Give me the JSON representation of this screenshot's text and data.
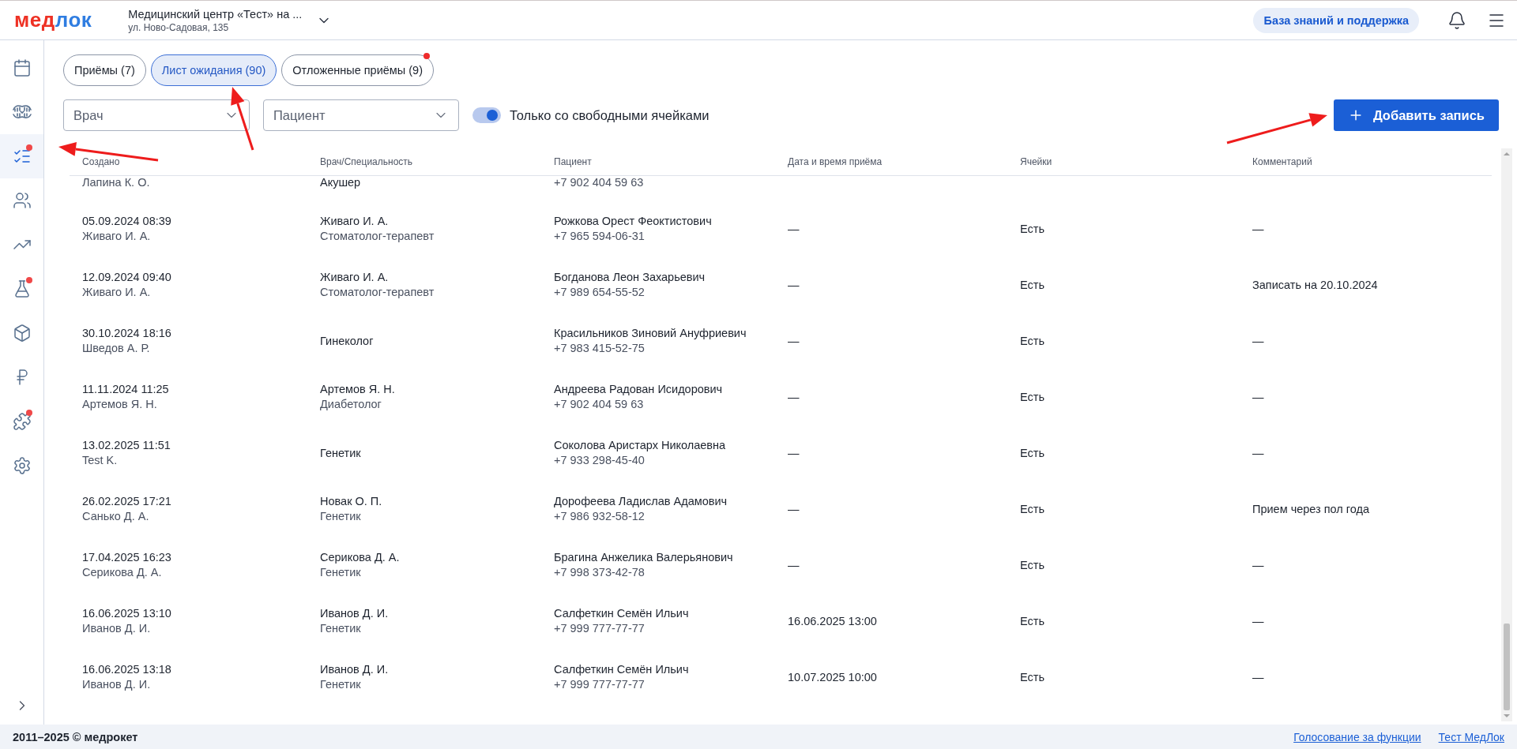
{
  "header": {
    "logo": {
      "primary": "мед",
      "secondary": "лок"
    },
    "clinic": {
      "name": "Медицинский центр «Тест» на ...",
      "address": "ул. Ново-Садовая, 135"
    },
    "support_button": "База знаний и поддержка"
  },
  "sidebar": {
    "items": [
      {
        "selected": false,
        "badge": false
      },
      {
        "selected": false,
        "badge": false
      },
      {
        "selected": true,
        "badge": true
      },
      {
        "selected": false,
        "badge": false
      },
      {
        "selected": false,
        "badge": false
      },
      {
        "selected": false,
        "badge": true
      },
      {
        "selected": false,
        "badge": false
      },
      {
        "selected": false,
        "badge": false
      },
      {
        "selected": false,
        "badge": true
      },
      {
        "selected": false,
        "badge": false
      }
    ]
  },
  "tabs": [
    {
      "label": "Приёмы (7)",
      "selected": false,
      "badge": false
    },
    {
      "label": "Лист ожидания (90)",
      "selected": true,
      "badge": false
    },
    {
      "label": "Отложенные приёмы (9)",
      "selected": false,
      "badge": true
    }
  ],
  "filters": {
    "doctor": {
      "placeholder": "Врач"
    },
    "patient": {
      "placeholder": "Пациент"
    },
    "free_slots_toggle": {
      "label": "Только со свободными ячейками",
      "on": true
    }
  },
  "add_button": "Добавить запись",
  "table": {
    "columns": [
      "Создано",
      "Врач/Специальность",
      "Пациент",
      "Дата и время приёма",
      "Ячейки",
      "Комментарий"
    ],
    "rows": [
      {
        "partial": true,
        "created_by": "Лапина К. О.",
        "specialty": "Акушер",
        "phone": "+7 902 404 59 63"
      },
      {
        "created": "05.09.2024 08:39",
        "created_by": "Живаго И. А.",
        "doctor": "Живаго И. А.",
        "specialty": "Стоматолог-терапевт",
        "patient": "Рожкова Орест Феоктистович",
        "phone": "+7 965 594-06-31",
        "appointment": "—",
        "slots": "Есть",
        "comment": "—"
      },
      {
        "created": "12.09.2024 09:40",
        "created_by": "Живаго И. А.",
        "doctor": "Живаго И. А.",
        "specialty": "Стоматолог-терапевт",
        "patient": "Богданова Леон Захарьевич",
        "phone": "+7 989 654-55-52",
        "appointment": "—",
        "slots": "Есть",
        "comment": "Записать на 20.10.2024"
      },
      {
        "created": "30.10.2024 18:16",
        "created_by": "Шведов А. Р.",
        "specialty": "Гинеколог",
        "patient": "Красильников Зиновий Ануфриевич",
        "phone": "+7 983 415-52-75",
        "appointment": "—",
        "slots": "Есть",
        "comment": "—"
      },
      {
        "created": "11.11.2024 11:25",
        "created_by": "Артемов Я. Н.",
        "doctor": "Артемов Я. Н.",
        "specialty": "Диабетолог",
        "patient": "Андреева Радован Исидорович",
        "phone": "+7 902 404 59 63",
        "appointment": "—",
        "slots": "Есть",
        "comment": "—"
      },
      {
        "created": "13.02.2025 11:51",
        "created_by": "Test K.",
        "specialty": "Генетик",
        "patient": "Соколова Аристарх Николаевна",
        "phone": "+7 933 298-45-40",
        "appointment": "—",
        "slots": "Есть",
        "comment": "—"
      },
      {
        "created": "26.02.2025 17:21",
        "created_by": "Санько Д. А.",
        "doctor": "Новак О. П.",
        "specialty": "Генетик",
        "patient": "Дорофеева Ладислав Адамович",
        "phone": "+7 986 932-58-12",
        "appointment": "—",
        "slots": "Есть",
        "comment": "Прием через пол года"
      },
      {
        "created": "17.04.2025 16:23",
        "created_by": "Серикова Д. А.",
        "doctor": "Серикова Д. А.",
        "specialty": "Генетик",
        "patient": "Брагина Анжелика Валерьянович",
        "phone": "+7 998 373-42-78",
        "appointment": "—",
        "slots": "Есть",
        "comment": "—"
      },
      {
        "created": "16.06.2025 13:10",
        "created_by": "Иванов Д. И.",
        "doctor": "Иванов Д. И.",
        "specialty": "Генетик",
        "patient": "Салфеткин Семён Ильич",
        "phone": "+7 999 777-77-77",
        "appointment": "16.06.2025 13:00",
        "slots": "Есть",
        "comment": "—"
      },
      {
        "created": "16.06.2025 13:18",
        "created_by": "Иванов Д. И.",
        "doctor": "Иванов Д. И.",
        "specialty": "Генетик",
        "patient": "Салфеткин Семён Ильич",
        "phone": "+7 999 777-77-77",
        "appointment": "10.07.2025 10:00",
        "slots": "Есть",
        "comment": "—"
      }
    ]
  },
  "footer": {
    "copyright": "2011–2025 © медрокет",
    "links": [
      "Голосование за функции",
      "Тест МедЛок"
    ]
  }
}
